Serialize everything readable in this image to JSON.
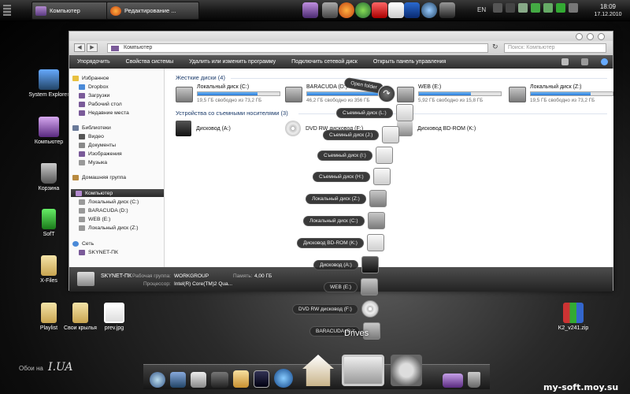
{
  "taskbar": {
    "tasks": [
      {
        "label": "Компьютер"
      },
      {
        "label": "Редактирование ..."
      }
    ],
    "tray_lang": "EN",
    "clock_time": "18:09",
    "clock_date": "17.12.2010"
  },
  "desktop": {
    "icons": [
      {
        "label": "System Explorer"
      },
      {
        "label": "Компьютер"
      },
      {
        "label": "Корзина"
      },
      {
        "label": "SofT"
      },
      {
        "label": "X-Files"
      },
      {
        "label": "Playlist"
      },
      {
        "label": "Свои крылья"
      },
      {
        "label": "prev.jpg"
      },
      {
        "label": "K2_v241.zip"
      }
    ]
  },
  "window": {
    "address": "Компьютер",
    "search_placeholder": "Поиск: Компьютер",
    "toolbar": [
      "Упорядочить",
      "Свойства системы",
      "Удалить или изменить программу",
      "Подключить сетевой диск",
      "Открыть панель управления"
    ],
    "nav": {
      "favorites": "Избранное",
      "fav_items": [
        "Dropbox",
        "Загрузки",
        "Рабочий стол",
        "Недавние места"
      ],
      "libraries": "Библиотеки",
      "lib_items": [
        "Видео",
        "Документы",
        "Изображения",
        "Музыка"
      ],
      "homegroup": "Домашняя группа",
      "computer": "Компьютер",
      "comp_items": [
        "Локальный диск (C:)",
        "BARACUDA (D:)",
        "WEB (E:)",
        "Локальный диск (Z:)"
      ],
      "network": "Сеть",
      "net_items": [
        "SKYNET-ПК"
      ]
    },
    "hdd_group": "Жесткие диски (4)",
    "hdds": [
      {
        "name": "Локальный диск (C:)",
        "free": "19,5 ГБ свободно из 73,2 ГБ",
        "used": 0.73
      },
      {
        "name": "BARACUDA (D:)",
        "free": "46,2 ГБ свободно из 356 ГБ",
        "used": 0.87
      },
      {
        "name": "WEB (E:)",
        "free": "5,92 ГБ свободно из 15,8 ГБ",
        "used": 0.63
      },
      {
        "name": "Локальный диск (Z:)",
        "free": "19,5 ГБ свободно из 73,2 ГБ",
        "used": 0.73
      }
    ],
    "removable_group": "Устройства со съемными носителями (3)",
    "removables": [
      {
        "name": "Дисковод (A:)"
      },
      {
        "name": "DVD RW дисковод (F:)"
      },
      {
        "name": "Дисковод BD-ROM (K:)"
      }
    ],
    "details": {
      "pc_name": "SKYNET-ПК",
      "workgroup_label": "Рабочая группа:",
      "workgroup": "WORKGROUP",
      "memory_label": "Память:",
      "memory": "4,00 ГБ",
      "cpu_label": "Процессор:",
      "cpu": "Intel(R) Core(TM)2 Qua..."
    }
  },
  "stack": {
    "open_folder": "Open folder",
    "items": [
      "Съемный диск (L:)",
      "Съемный диск (J:)",
      "Съемный диск (I:)",
      "Съемный диск (H:)",
      "Локальный диск (Z:)",
      "Локальный диск (C:)",
      "Дисковод BD-ROM (K:)",
      "Дисковод (A:)",
      "WEB (E:)",
      "DVD RW дисковод (F:)",
      "BARACUDA (D:)"
    ],
    "title": "Drives"
  },
  "wallpaper": {
    "credit": "Обои на",
    "credit_logo": "I.UA"
  },
  "watermark": "my-soft.moy.su"
}
